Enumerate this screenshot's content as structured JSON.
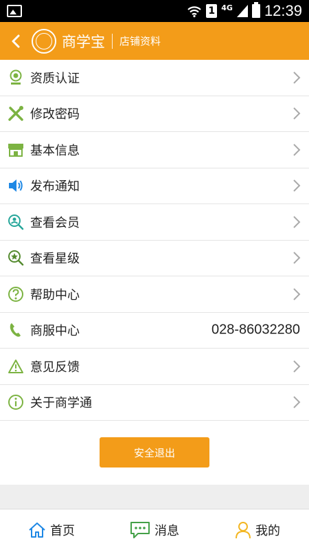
{
  "status_bar": {
    "time": "12:39",
    "network": "4G",
    "sim": "1"
  },
  "header": {
    "brand": "商学宝",
    "subtitle": "店铺资料"
  },
  "colors": {
    "accent": "#f39c19",
    "green": "#7cb342",
    "blue": "#1e88e5"
  },
  "menu": [
    {
      "label": "资质认证",
      "icon": "certificate-icon"
    },
    {
      "label": "修改密码",
      "icon": "tools-icon"
    },
    {
      "label": "基本信息",
      "icon": "store-icon"
    },
    {
      "label": "发布通知",
      "icon": "speaker-icon"
    },
    {
      "label": "查看会员",
      "icon": "member-search-icon"
    },
    {
      "label": "查看星级",
      "icon": "star-search-icon"
    },
    {
      "label": "帮助中心",
      "icon": "help-icon"
    },
    {
      "label": "商服中心",
      "icon": "phone-icon",
      "value": "028-86032280"
    },
    {
      "label": "意见反馈",
      "icon": "warning-icon"
    },
    {
      "label": "关于商学通",
      "icon": "info-icon"
    }
  ],
  "logout": {
    "label": "安全退出"
  },
  "tabs": [
    {
      "label": "首页",
      "icon": "home-icon"
    },
    {
      "label": "消息",
      "icon": "message-icon"
    },
    {
      "label": "我的",
      "icon": "user-icon"
    }
  ]
}
